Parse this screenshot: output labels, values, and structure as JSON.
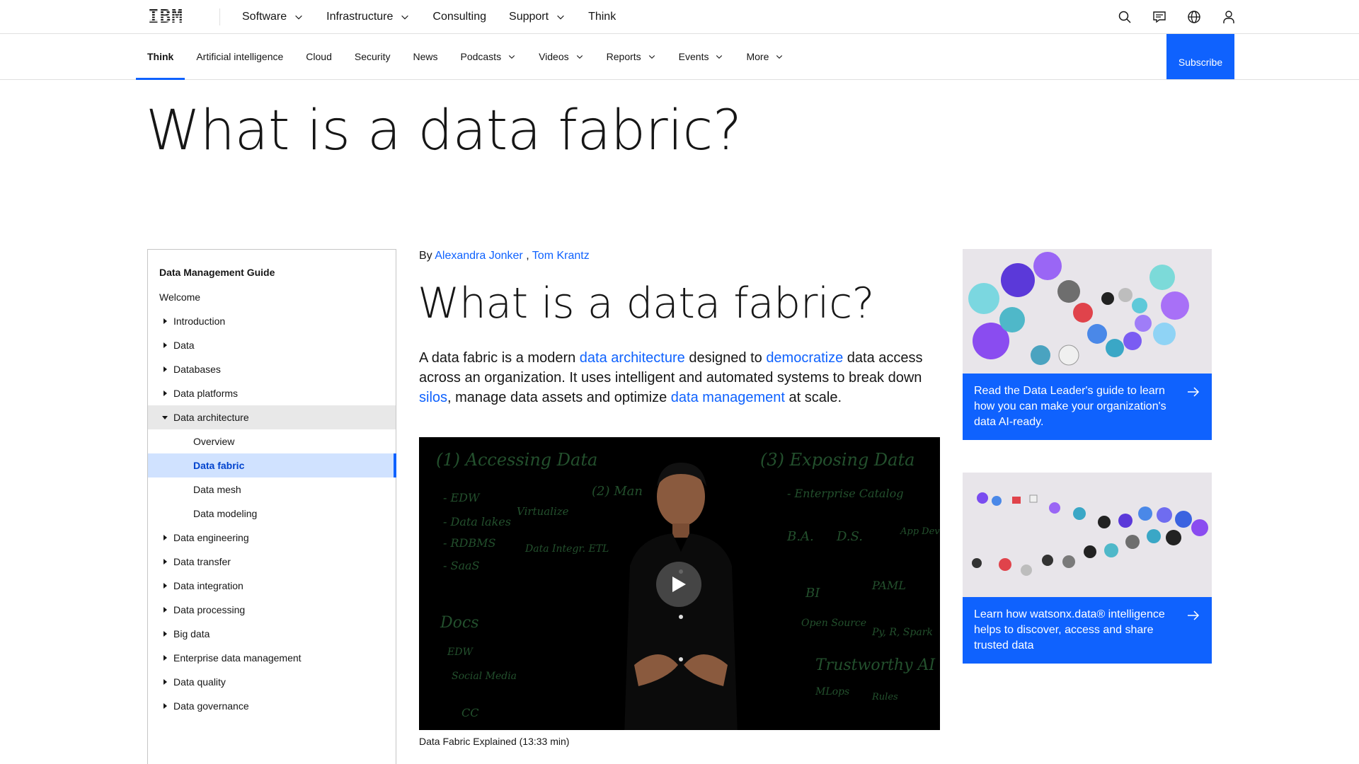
{
  "masthead": {
    "logo": "IBM",
    "nav": [
      {
        "label": "Software",
        "dropdown": true
      },
      {
        "label": "Infrastructure",
        "dropdown": true
      },
      {
        "label": "Consulting",
        "dropdown": false
      },
      {
        "label": "Support",
        "dropdown": true
      },
      {
        "label": "Think",
        "dropdown": false
      }
    ],
    "icons": [
      "search-icon",
      "chat-icon",
      "globe-icon",
      "user-icon"
    ]
  },
  "subnav": {
    "items": [
      {
        "label": "Think",
        "dropdown": false,
        "active": true
      },
      {
        "label": "Artificial intelligence",
        "dropdown": false
      },
      {
        "label": "Cloud",
        "dropdown": false
      },
      {
        "label": "Security",
        "dropdown": false
      },
      {
        "label": "News",
        "dropdown": false
      },
      {
        "label": "Podcasts",
        "dropdown": true
      },
      {
        "label": "Videos",
        "dropdown": true
      },
      {
        "label": "Reports",
        "dropdown": true
      },
      {
        "label": "Events",
        "dropdown": true
      },
      {
        "label": "More",
        "dropdown": true
      }
    ],
    "subscribe_label": "Subscribe"
  },
  "page_heading": "What is a data fabric?",
  "toc": {
    "title": "Data Management Guide",
    "items": [
      {
        "label": "Welcome",
        "level": 0,
        "caret": "none"
      },
      {
        "label": "Introduction",
        "level": 1,
        "caret": "right"
      },
      {
        "label": "Data",
        "level": 1,
        "caret": "right"
      },
      {
        "label": "Databases",
        "level": 1,
        "caret": "right"
      },
      {
        "label": "Data platforms",
        "level": 1,
        "caret": "right"
      },
      {
        "label": "Data architecture",
        "level": 1,
        "caret": "down",
        "expanded": true
      },
      {
        "label": "Overview",
        "level": 2,
        "caret": "none"
      },
      {
        "label": "Data fabric",
        "level": 2,
        "caret": "none",
        "selected": true
      },
      {
        "label": "Data mesh",
        "level": 2,
        "caret": "none"
      },
      {
        "label": "Data modeling",
        "level": 2,
        "caret": "none"
      },
      {
        "label": "Data engineering",
        "level": 1,
        "caret": "right"
      },
      {
        "label": "Data transfer",
        "level": 1,
        "caret": "right"
      },
      {
        "label": "Data integration",
        "level": 1,
        "caret": "right"
      },
      {
        "label": "Data processing",
        "level": 1,
        "caret": "right"
      },
      {
        "label": "Big data",
        "level": 1,
        "caret": "right"
      },
      {
        "label": "Enterprise data management",
        "level": 1,
        "caret": "right"
      },
      {
        "label": "Data quality",
        "level": 1,
        "caret": "right"
      },
      {
        "label": "Data governance",
        "level": 1,
        "caret": "right"
      }
    ]
  },
  "article": {
    "by": "By",
    "authors": [
      "Alexandra Jonker",
      "Tom Krantz"
    ],
    "author_sep": " , ",
    "title": "What is a data fabric?",
    "lead": {
      "t1": "A data fabric is a modern ",
      "l1": "data architecture",
      "t2": " designed to ",
      "l2": "democratize",
      "t3": " data access across an organization. It uses intelligent and automated systems to break down ",
      "l3": "silos",
      "t4": ", manage data assets and optimize ",
      "l4": "data management",
      "t5": " at scale."
    },
    "video": {
      "caption": "Data Fabric Explained (13:33 min)",
      "board_text": [
        "(1) Accessing Data",
        "(3) Exposing Data",
        "- EDW",
        "- Data lakes",
        "- RDBMS",
        "- SaaS",
        "Virtualize",
        "Data Integr. ETL",
        "(2) Man",
        "- Enterprise Catalog",
        "B.A.",
        "D.S.",
        "App Dev",
        "BI",
        "PAML",
        "Open Source",
        "Py, R, Spark",
        "Trustworthy AI",
        "MLops",
        "Rules",
        "Docs",
        "EDW",
        "Social Media",
        "CC"
      ]
    }
  },
  "promos": [
    {
      "text": "Read the Data Leader's guide to learn how you can make your organization's data AI-ready."
    },
    {
      "text": "Learn how watsonx.data® intelligence helps to discover, access and share trusted data"
    }
  ],
  "colors": {
    "accent": "#0f62fe",
    "text": "#161616",
    "selected_bg": "#d0e2ff",
    "expanded_bg": "#e8e8e8"
  }
}
